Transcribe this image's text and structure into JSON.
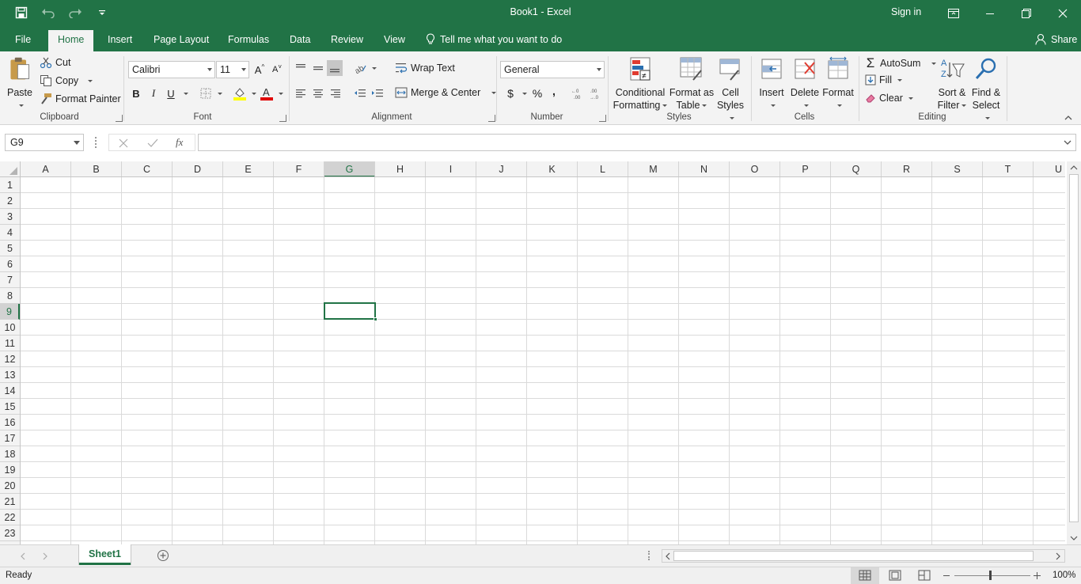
{
  "window": {
    "title": "Book1  -  Excel",
    "sign_in": "Sign in"
  },
  "tabs": [
    {
      "label": "File"
    },
    {
      "label": "Home"
    },
    {
      "label": "Insert"
    },
    {
      "label": "Page Layout"
    },
    {
      "label": "Formulas"
    },
    {
      "label": "Data"
    },
    {
      "label": "Review"
    },
    {
      "label": "View"
    }
  ],
  "tell_me": "Tell me what you want to do",
  "share": "Share",
  "ribbon": {
    "clipboard": {
      "label": "Clipboard",
      "paste": "Paste",
      "cut": "Cut",
      "copy": "Copy",
      "format_painter": "Format Painter"
    },
    "font": {
      "label": "Font",
      "font_name": "Calibri",
      "font_size": "11"
    },
    "alignment": {
      "label": "Alignment",
      "wrap_text": "Wrap Text",
      "merge_center": "Merge & Center"
    },
    "number": {
      "label": "Number",
      "format": "General",
      "currency": "$",
      "percent": "%",
      "comma": ","
    },
    "styles": {
      "label": "Styles",
      "conditional_1": "Conditional",
      "conditional_2": "Formatting",
      "table_1": "Format as",
      "table_2": "Table",
      "cell_1": "Cell",
      "cell_2": "Styles"
    },
    "cells": {
      "label": "Cells",
      "insert": "Insert",
      "delete": "Delete",
      "format": "Format"
    },
    "editing": {
      "label": "Editing",
      "autosum": "AutoSum",
      "fill": "Fill",
      "clear": "Clear",
      "sort_1": "Sort &",
      "sort_2": "Filter",
      "find_1": "Find &",
      "find_2": "Select"
    }
  },
  "formula_bar": {
    "name_box": "G9",
    "fx": "fx",
    "formula": ""
  },
  "grid": {
    "columns": [
      "A",
      "B",
      "C",
      "D",
      "E",
      "F",
      "G",
      "H",
      "I",
      "J",
      "K",
      "L",
      "M",
      "N",
      "O",
      "P",
      "Q",
      "R",
      "S",
      "T",
      "U"
    ],
    "rows": [
      "1",
      "2",
      "3",
      "4",
      "5",
      "6",
      "7",
      "8",
      "9",
      "10",
      "11",
      "12",
      "13",
      "14",
      "15",
      "16",
      "17",
      "18",
      "19",
      "20",
      "21",
      "22",
      "23"
    ],
    "selected_column": "G",
    "selected_row": "9"
  },
  "sheets": {
    "active": "Sheet1"
  },
  "status": {
    "ready": "Ready",
    "zoom": "100%"
  },
  "colors": {
    "accent": "#217346",
    "ribbon_bg": "#f3f3f3",
    "grid_line": "#dadada"
  }
}
